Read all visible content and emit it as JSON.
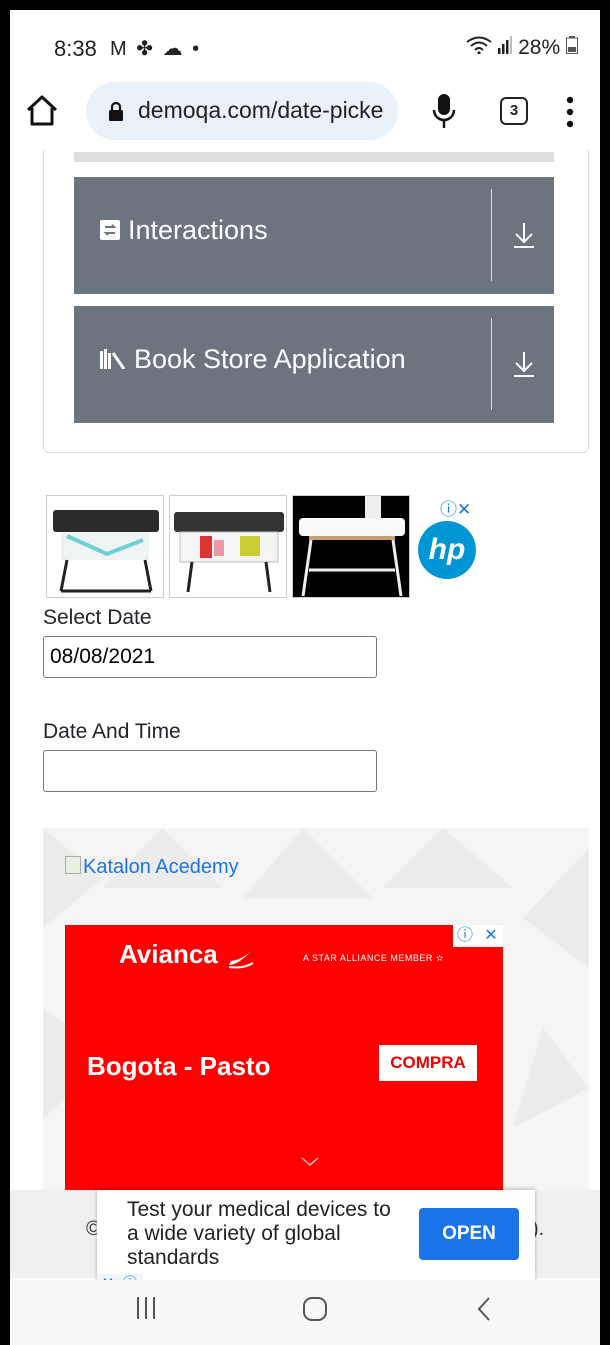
{
  "status": {
    "time": "8:38",
    "notif_icons": "M ✤ ☁ •",
    "battery": "28%"
  },
  "browser": {
    "url": "demoqa.com/date-picke",
    "tab_count": "3"
  },
  "menu": {
    "groups": [
      {
        "label": "Interactions"
      },
      {
        "label": "Book Store Application"
      }
    ]
  },
  "ad_top": {
    "brand": "hp",
    "choice": "ⓘ✕"
  },
  "form": {
    "select_date_label": "Select Date",
    "select_date_value": "08/08/2021",
    "date_time_label": "Date And Time",
    "date_time_value": ""
  },
  "banner": {
    "katalon_alt": "Katalon Acedemy",
    "avianca_brand": "Avianca",
    "star_alliance": "A STAR ALLIANCE MEMBER ✫",
    "route": "Bogota - Pasto",
    "cta": "COMPRA",
    "ad_info": "ⓘ",
    "ad_close": "✕"
  },
  "footer": {
    "left_fragment": "©",
    "right_fragment": ")."
  },
  "popup": {
    "message": "Test your medical devices to a wide variety of global standards",
    "cta": "OPEN",
    "close": "✕",
    "info": "ⓘ"
  },
  "colors": {
    "menu_group": "#6c757d",
    "avianca_red": "#ff0000",
    "accent": "#1a73e8"
  }
}
